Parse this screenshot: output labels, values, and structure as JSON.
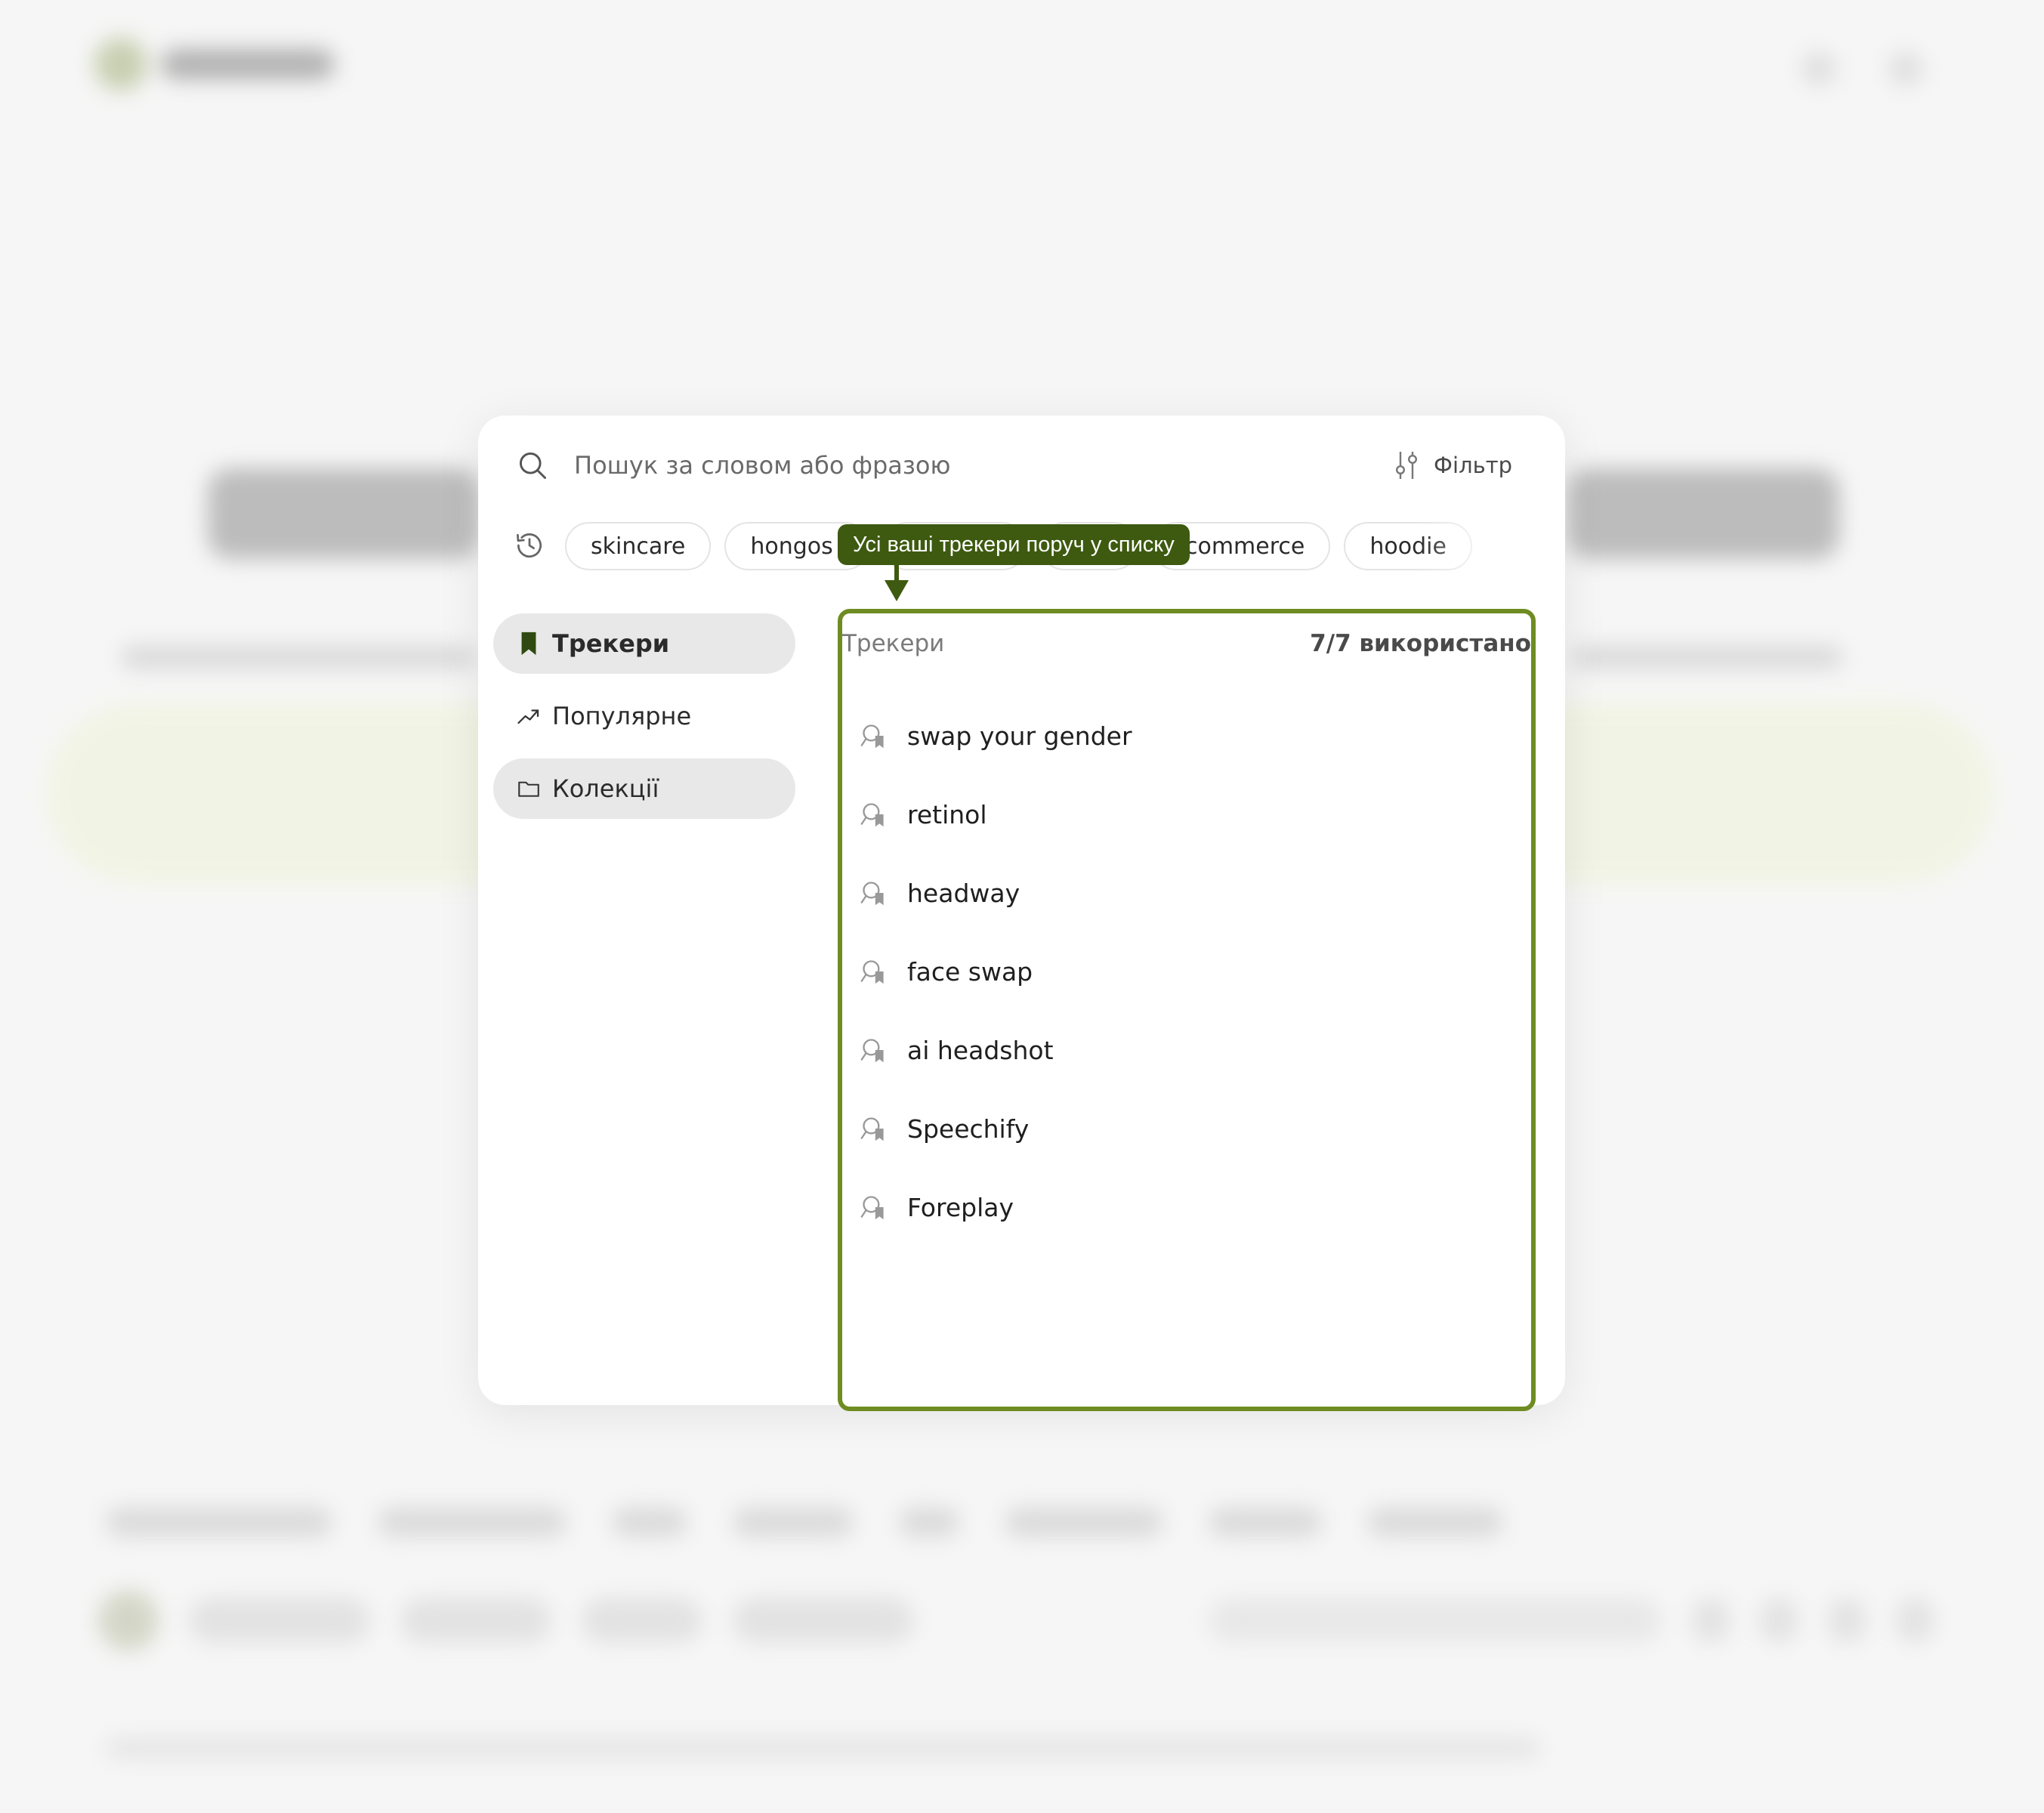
{
  "search": {
    "placeholder": "Пошук за словом або фразою",
    "filter_label": "Фільтр"
  },
  "recent_chips": [
    "skincare",
    "hongos",
    "",
    "",
    "ecommerce",
    "hoodie"
  ],
  "nav": {
    "items": [
      {
        "label": "Трекери",
        "icon": "bookmark-icon"
      },
      {
        "label": "Популярне",
        "icon": "trending-up-icon"
      },
      {
        "label": "Колекції",
        "icon": "folder-icon"
      }
    ]
  },
  "trackers": {
    "title": "Трекери",
    "usage": "7/7 використано",
    "items": [
      {
        "label": "swap your gender"
      },
      {
        "label": "retinol"
      },
      {
        "label": "headway"
      },
      {
        "label": "face swap"
      },
      {
        "label": "ai headshot"
      },
      {
        "label": "Speechify"
      },
      {
        "label": "Foreplay"
      }
    ]
  },
  "tooltip": {
    "text": "Усі ваші трекери поруч у списку"
  },
  "colors": {
    "accent": "#6e8c22",
    "tooltip_bg": "#3d5a10",
    "active_nav_bg": "#e8e8e8"
  }
}
